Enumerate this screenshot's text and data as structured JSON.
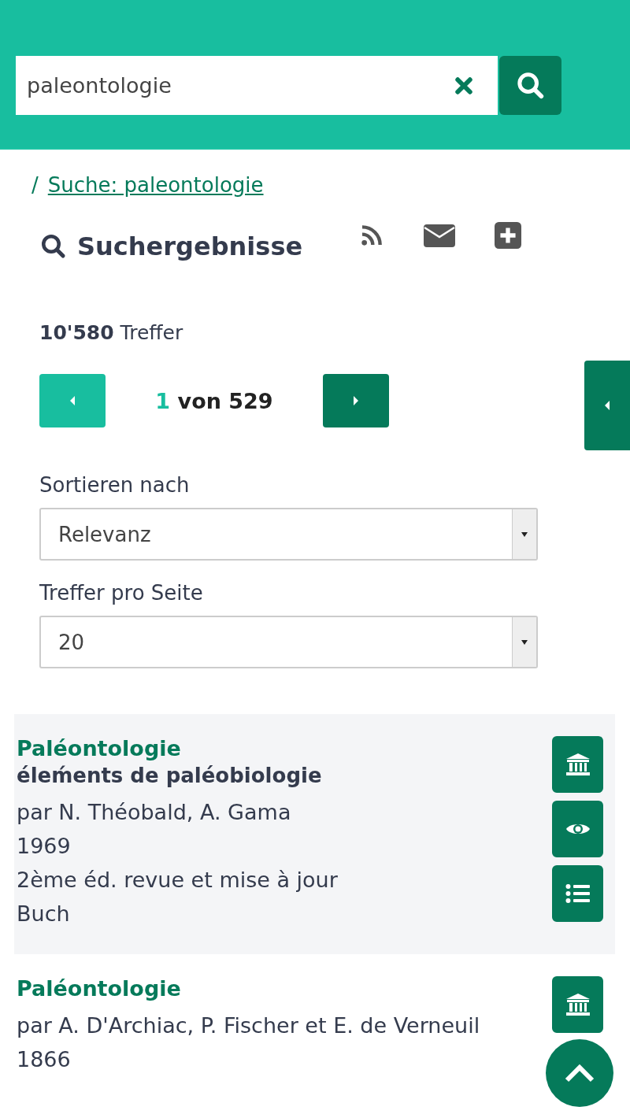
{
  "search": {
    "value": "paleontologie"
  },
  "breadcrumb": {
    "separator": "/",
    "link": "Suche: paleontologie"
  },
  "heading": "Suchergebnisse",
  "hits": {
    "count": "10'580",
    "label": "Treffer"
  },
  "pagination": {
    "current": "1",
    "of": "von 529"
  },
  "sort": {
    "label": "Sortieren nach",
    "value": "Relevanz"
  },
  "per_page": {
    "label": "Treffer pro Seite",
    "value": "20"
  },
  "results": [
    {
      "title": "Paléontologie",
      "subtitle": "éleḿents de paléobiologie",
      "lines": [
        "par N. Théobald, A. Gama",
        "1969",
        "2ème éd. revue et mise à jour",
        "Buch"
      ],
      "actions": [
        {
          "kind": "institution"
        },
        {
          "kind": "eye"
        },
        {
          "kind": "list"
        }
      ]
    },
    {
      "title": "Paléontologie",
      "lines": [
        "par A. D'Archiac, P. Fischer et E. de Verneuil",
        "1866"
      ],
      "actions": [
        {
          "kind": "institution"
        }
      ]
    }
  ]
}
